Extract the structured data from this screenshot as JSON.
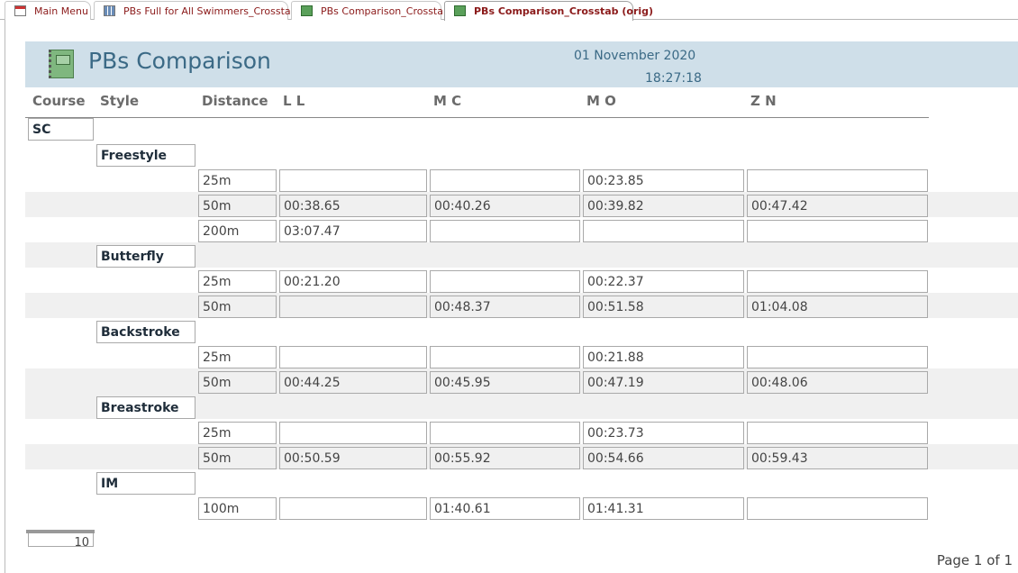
{
  "tabs": [
    {
      "label": "Main Menu",
      "icon": "form-icon",
      "active": false
    },
    {
      "label": "PBs Full for All Swimmers_Crosstab",
      "icon": "query-icon",
      "active": false
    },
    {
      "label": "PBs Comparison_Crosstab",
      "icon": "report-icon",
      "active": false
    },
    {
      "label": "PBs Comparison_Crosstab (orig)",
      "icon": "report-icon",
      "active": true
    }
  ],
  "report": {
    "title": "PBs Comparison",
    "date": "01 November 2020",
    "time": "18:27:18",
    "headers": {
      "course": "Course",
      "style": "Style",
      "distance": "Distance",
      "s1": "L L",
      "s2": "M C",
      "s3": "M O",
      "s4": "Z N"
    },
    "count": "10",
    "page": "Page 1 of 1"
  },
  "rows": [
    {
      "type": "course",
      "label": "SC"
    },
    {
      "type": "style",
      "label": "Freestyle"
    },
    {
      "type": "dist",
      "label": "25m",
      "vals": [
        "",
        "",
        "00:23.85",
        ""
      ]
    },
    {
      "type": "dist",
      "label": "50m",
      "shade": true,
      "vals": [
        "00:38.65",
        "00:40.26",
        "00:39.82",
        "00:47.42"
      ]
    },
    {
      "type": "dist",
      "label": "200m",
      "vals": [
        "03:07.47",
        "",
        "",
        ""
      ]
    },
    {
      "type": "style",
      "label": "Butterfly",
      "shade": true
    },
    {
      "type": "dist",
      "label": "25m",
      "vals": [
        "00:21.20",
        "",
        "00:22.37",
        ""
      ]
    },
    {
      "type": "dist",
      "label": "50m",
      "shade": true,
      "vals": [
        "",
        "00:48.37",
        "00:51.58",
        "01:04.08"
      ]
    },
    {
      "type": "style",
      "label": "Backstroke"
    },
    {
      "type": "dist",
      "label": "25m",
      "vals": [
        "",
        "",
        "00:21.88",
        ""
      ]
    },
    {
      "type": "dist",
      "label": "50m",
      "shade": true,
      "vals": [
        "00:44.25",
        "00:45.95",
        "00:47.19",
        "00:48.06"
      ]
    },
    {
      "type": "style",
      "label": "Breastroke",
      "shade": true
    },
    {
      "type": "dist",
      "label": "25m",
      "vals": [
        "",
        "",
        "00:23.73",
        ""
      ]
    },
    {
      "type": "dist",
      "label": "50m",
      "shade": true,
      "vals": [
        "00:50.59",
        "00:55.92",
        "00:54.66",
        "00:59.43"
      ]
    },
    {
      "type": "style",
      "label": "IM"
    },
    {
      "type": "dist",
      "label": "100m",
      "vals": [
        "",
        "01:40.61",
        "01:41.31",
        ""
      ]
    }
  ]
}
